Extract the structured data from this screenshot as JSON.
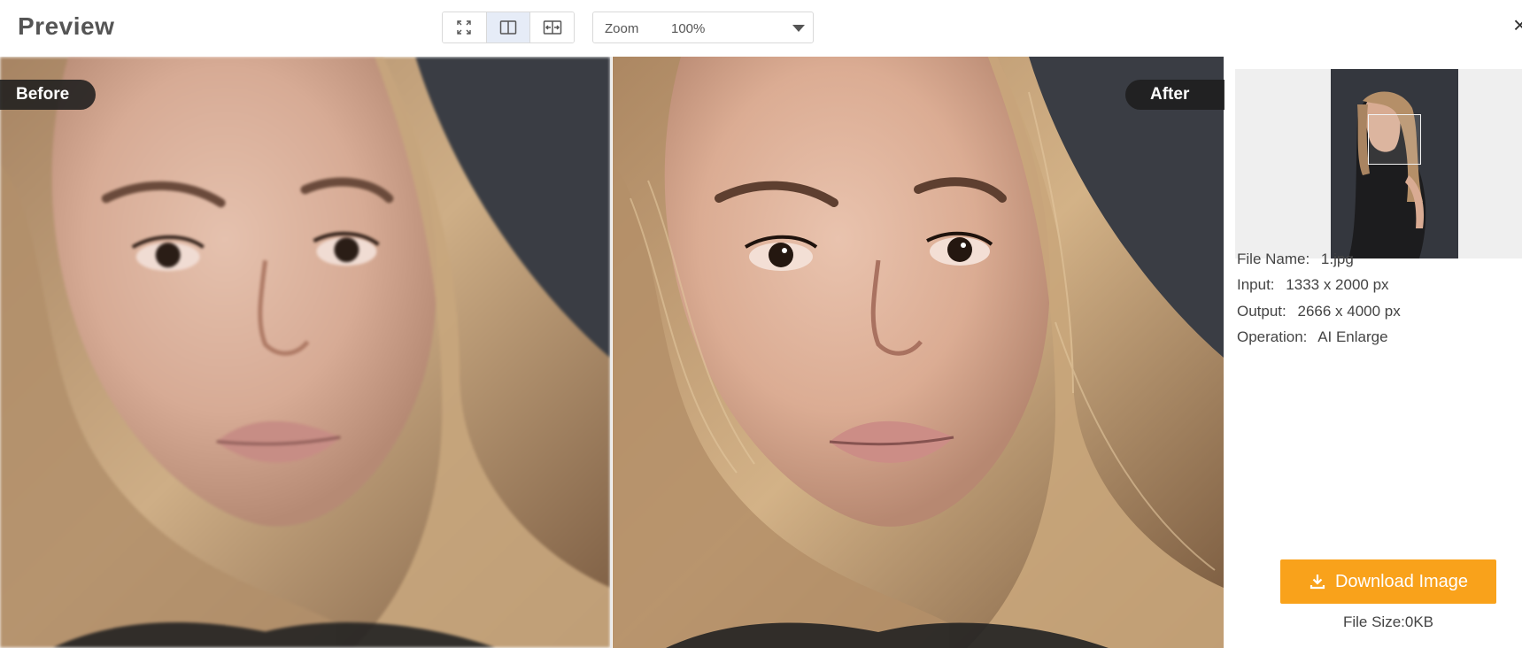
{
  "header": {
    "title": "Preview",
    "view_modes": [
      {
        "icon": "fit-screen-icon",
        "active": false
      },
      {
        "icon": "split-view-icon",
        "active": true
      },
      {
        "icon": "compare-slider-icon",
        "active": false
      }
    ],
    "zoom": {
      "label": "Zoom",
      "value": "100%"
    },
    "close_icon": "close-icon"
  },
  "compare": {
    "before_label": "Before",
    "after_label": "After"
  },
  "sidebar": {
    "file_name_label": "File Name:",
    "file_name": "1.jpg",
    "input_label": "Input:",
    "input_value": "1333 x 2000 px",
    "output_label": "Output:",
    "output_value": "2666 x 4000 px",
    "operation_label": "Operation:",
    "operation_value": "AI Enlarge",
    "download_label": "Download Image",
    "download_icon": "download-icon",
    "file_size": "File Size:0KB"
  },
  "colors": {
    "accent": "#f9a21b",
    "active_view": "#e6ecf7",
    "background_dark": "#3a3d44"
  }
}
